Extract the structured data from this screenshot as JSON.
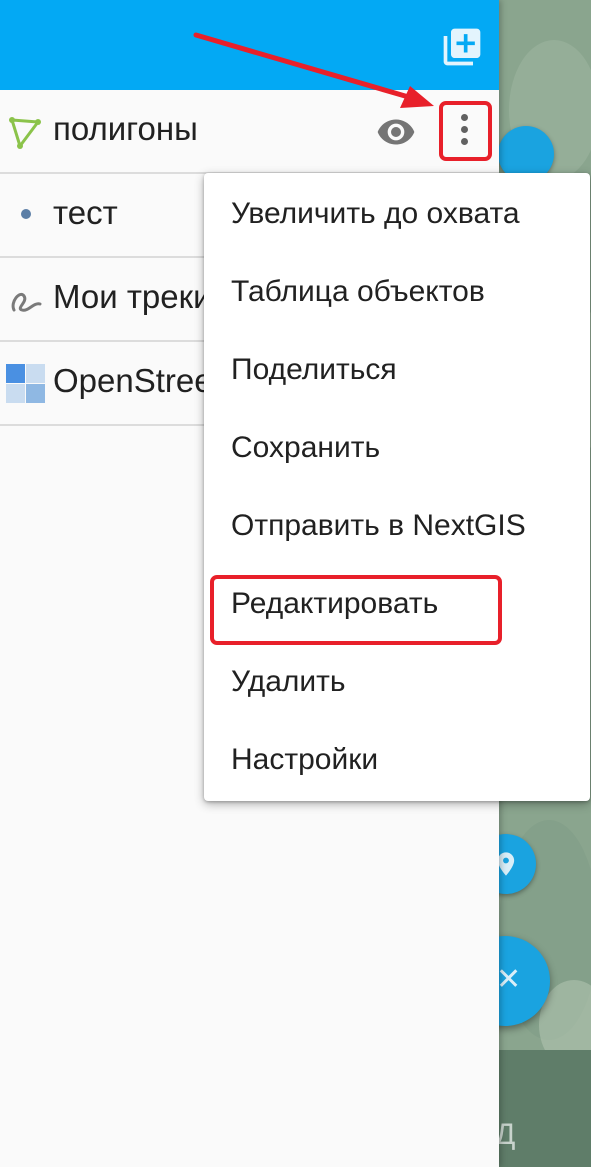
{
  "layers": [
    {
      "name": "полигоны",
      "icon": "polygon-icon"
    },
    {
      "name": "тест",
      "icon": "point-icon"
    },
    {
      "name": "Мои треки",
      "icon": "track-icon"
    },
    {
      "name": "OpenStreetMap",
      "icon": "tile-layer-icon"
    }
  ],
  "menu": {
    "items": [
      "Увеличить до охвата",
      "Таблица объектов",
      "Поделиться",
      "Сохранить",
      "Отправить в NextGIS",
      "Редактировать",
      "Удалить",
      "Настройки"
    ]
  },
  "map": {
    "bottom_text": "Д"
  },
  "colors": {
    "header": "#03a9f4",
    "accent": "#1aa3e0",
    "annotation": "#e8202a",
    "polygon_icon": "#8bc34a",
    "point_icon": "#5b7ea6"
  }
}
